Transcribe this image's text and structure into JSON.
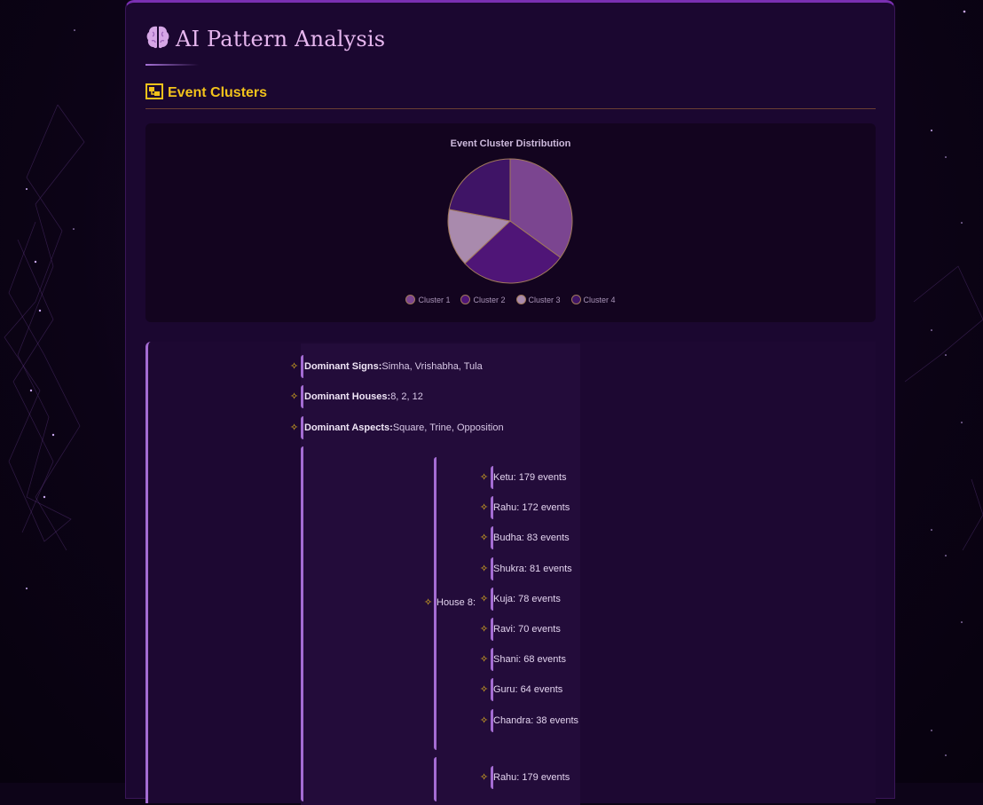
{
  "header": {
    "title": "AI Pattern Analysis",
    "icon": "brain-icon"
  },
  "section": {
    "title": "Event Clusters",
    "icon": "cluster-icon"
  },
  "chart_data": {
    "type": "pie",
    "title": "Event Cluster Distribution",
    "categories": [
      "Cluster 1",
      "Cluster 2",
      "Cluster 3",
      "Cluster 4"
    ],
    "values": [
      35,
      28,
      15,
      22
    ],
    "colors": [
      "#7b4590",
      "#4f1577",
      "#a98aad",
      "#3f1466"
    ],
    "legend": "bottom"
  },
  "details": {
    "dominant_signs_key": "Dominant Signs:",
    "dominant_signs_val": "Simha, Vrishabha, Tula",
    "dominant_houses_key": "Dominant Houses:",
    "dominant_houses_val": "8, 2, 12",
    "dominant_aspects_key": "Dominant Aspects:",
    "dominant_aspects_val": "Square, Trine, Opposition"
  },
  "houses": [
    {
      "label": "House 8:",
      "events": [
        "Ketu: 179 events",
        "Rahu: 172 events",
        "Budha: 83 events",
        "Shukra: 81 events",
        "Kuja: 78 events",
        "Ravi: 70 events",
        "Shani: 68 events",
        "Guru: 64 events",
        "Chandra: 38 events"
      ]
    },
    {
      "label": "",
      "events": [
        "Rahu: 179 events"
      ]
    }
  ],
  "colors": {
    "accent_gold": "#f2c21b",
    "accent_purple": "#a46cd3",
    "title_pink": "#e6b6ee"
  }
}
